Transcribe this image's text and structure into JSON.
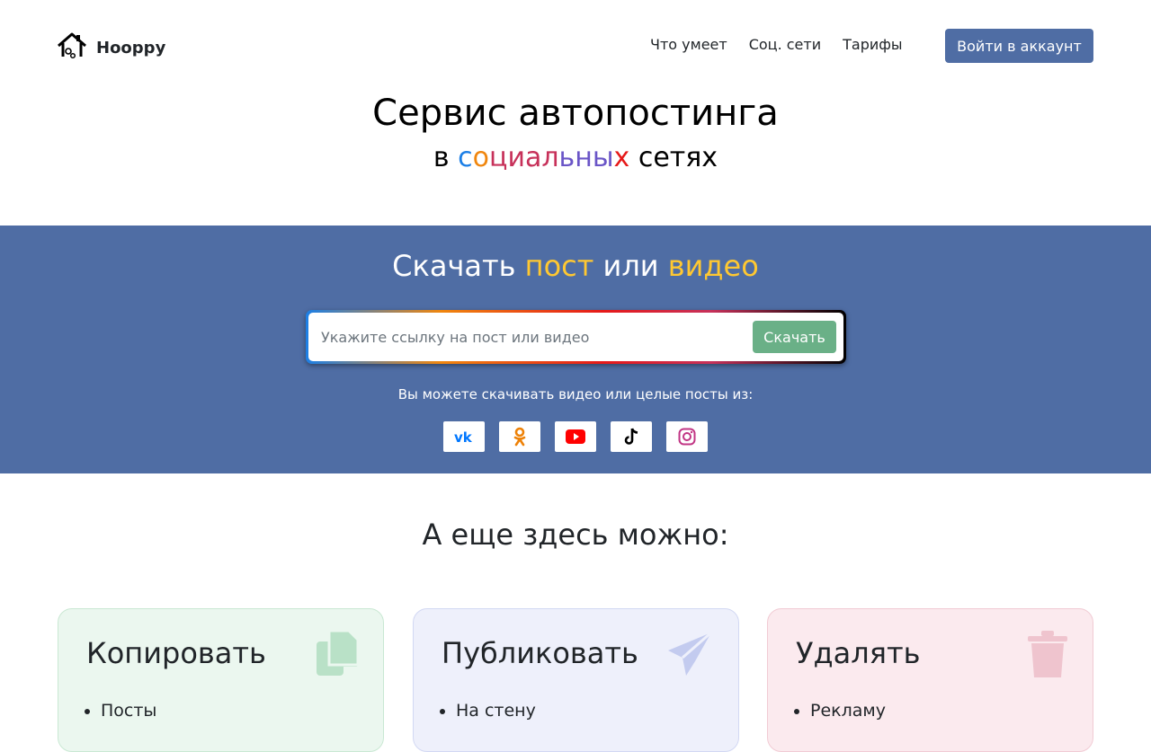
{
  "brand": {
    "name": "Hooppy"
  },
  "nav": {
    "links": [
      "Что умеет",
      "Соц. сети",
      "Тарифы"
    ],
    "login": "Войти в аккаунт"
  },
  "hero": {
    "title": "Сервис автопостинга",
    "subtitle_prefix": "в",
    "subtitle_colored": [
      "с",
      "о",
      "ц",
      "и",
      "а",
      "л",
      "ь",
      "н",
      "ы",
      "х"
    ],
    "subtitle_suffix": "сетях"
  },
  "download": {
    "title_parts": [
      "Скачать",
      "пост",
      "или",
      "видео"
    ],
    "placeholder": "Укажите ссылку на пост или видео",
    "button": "Скачать",
    "hint": "Вы можете скачивать видео или целые посты из:",
    "socials": [
      "vk-icon",
      "odnoklassniki-icon",
      "youtube-icon",
      "tiktok-icon",
      "instagram-icon"
    ]
  },
  "features": {
    "title": "А еще здесь можно:",
    "cards": [
      {
        "title": "Копировать",
        "items": [
          "Посты"
        ],
        "icon": "copy-icon"
      },
      {
        "title": "Публиковать",
        "items": [
          "На стену"
        ],
        "icon": "paper-plane-icon"
      },
      {
        "title": "Удалять",
        "items": [
          "Рекламу"
        ],
        "icon": "trash-icon"
      }
    ]
  },
  "colors": {
    "primary": "#4f6da4",
    "accent": "#ffc831",
    "success": "#6ab087"
  }
}
